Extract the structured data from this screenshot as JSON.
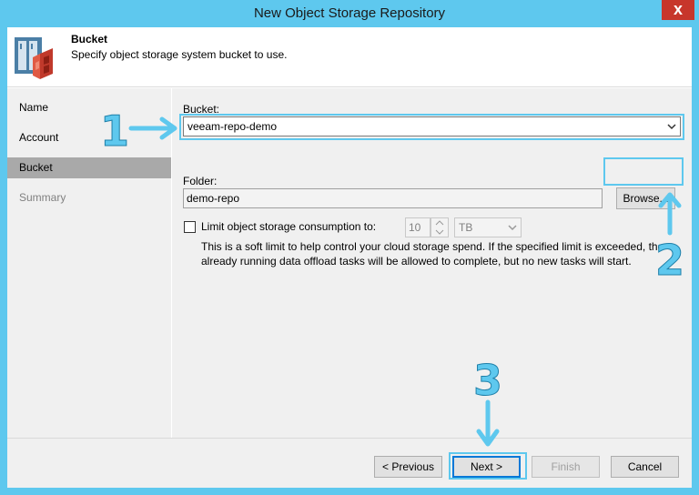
{
  "window": {
    "title": "New Object Storage Repository",
    "close_glyph": "x"
  },
  "header": {
    "title": "Bucket",
    "subtitle": "Specify object storage system bucket to use.",
    "logo_icon": "object-storage-icon"
  },
  "sidebar": {
    "items": [
      {
        "label": "Name",
        "state": "normal"
      },
      {
        "label": "Account",
        "state": "normal"
      },
      {
        "label": "Bucket",
        "state": "active"
      },
      {
        "label": "Summary",
        "state": "disabled"
      }
    ]
  },
  "form": {
    "bucket_label": "Bucket:",
    "bucket_value": "veeam-repo-demo",
    "folder_label": "Folder:",
    "folder_value": "demo-repo",
    "browse_label": "Browse...",
    "limit_label": "Limit object storage consumption to:",
    "limit_checked": false,
    "limit_value": "10",
    "limit_unit": "TB",
    "limit_desc": "This is a soft limit to help control your cloud storage spend. If the specified limit is exceeded, the already running data offload tasks will be allowed to complete, but no new tasks will start."
  },
  "footer": {
    "previous_label": "< Previous",
    "next_label": "Next >",
    "finish_label": "Finish",
    "cancel_label": "Cancel"
  },
  "annotations": {
    "step1": "1",
    "step2": "2",
    "step3": "3",
    "color": "#5ec8ee"
  }
}
